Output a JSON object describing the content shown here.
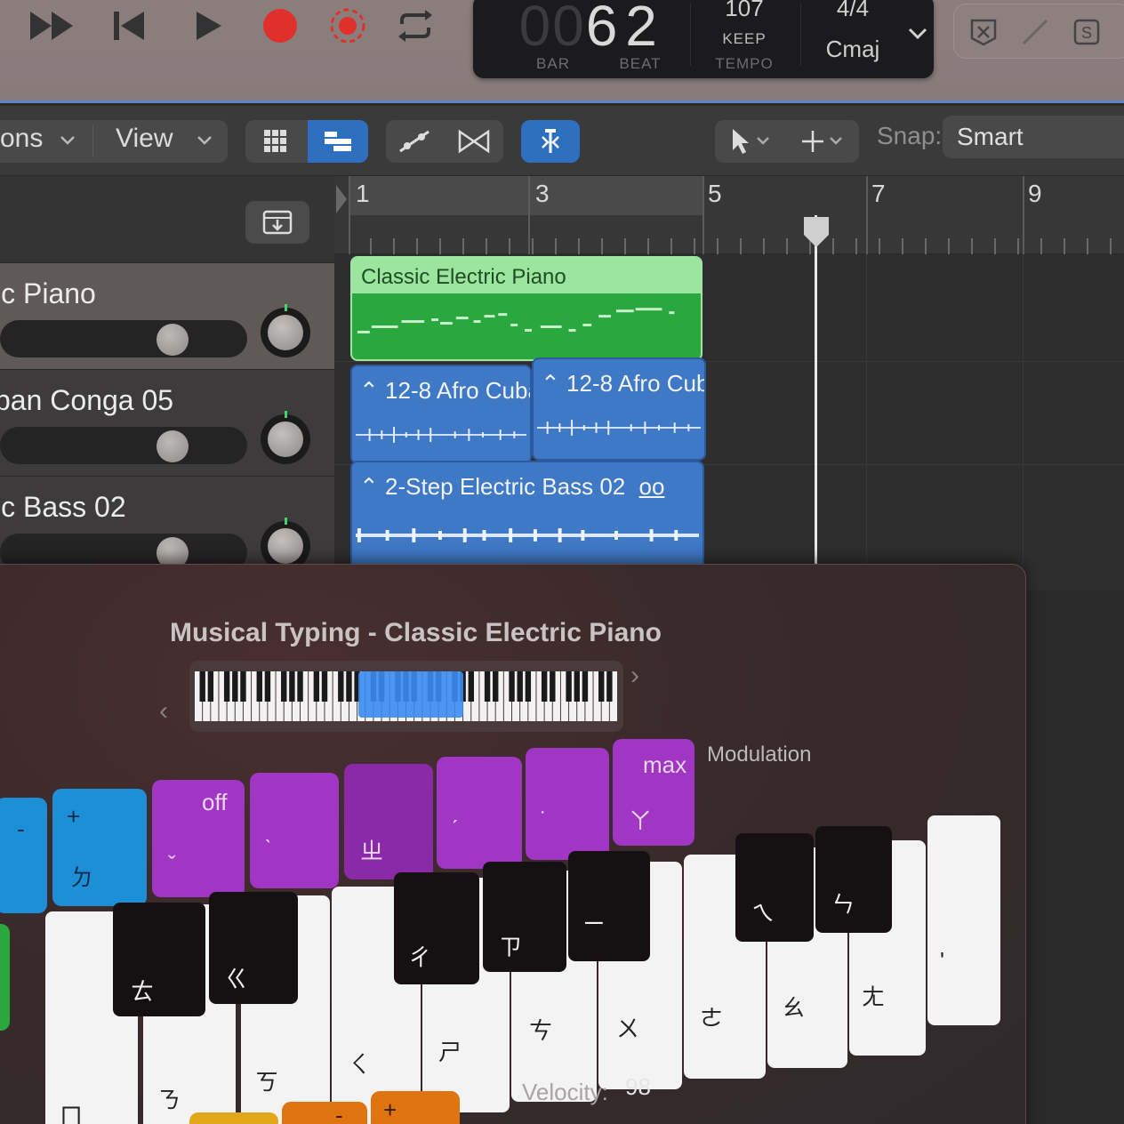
{
  "transport": {
    "lcd": {
      "bar_dim": "00",
      "bar": "6",
      "beat": "2",
      "bar_label": "BAR",
      "beat_label": "BEAT",
      "tempo": "107",
      "tempo_mode": "KEEP",
      "tempo_label": "TEMPO",
      "time_sig": "4/4",
      "key": "Cmaj"
    },
    "record_color": "#e0302b"
  },
  "toolbar": {
    "menu1": "ons",
    "menu2": "View",
    "snap_label": "Snap:",
    "snap_value": "Smart"
  },
  "tracks": [
    {
      "name": "ic Piano"
    },
    {
      "name": "ban Conga 05"
    },
    {
      "name": "ic Bass 02"
    }
  ],
  "ruler": {
    "bars": [
      "1",
      "3",
      "5",
      "7",
      "9"
    ]
  },
  "regions": {
    "piano": "Classic Electric Piano",
    "conga_a": "12-8 Afro Cuba",
    "conga_b": "12-8 Afro Cuba",
    "bass": "2-Step Electric Bass 02",
    "loop_glyph": "oo"
  },
  "musical_typing": {
    "title": "Musical Typing - Classic Electric Piano",
    "modulation_label": "Modulation",
    "velocity_label": "Velocity:",
    "velocity_value": "98",
    "octave_keys": {
      "minus": "-",
      "plus": "+",
      "plus_zhuyin": "ㄉ"
    },
    "mod_keys": {
      "off": "off",
      "off_zhuyin": "ˇ",
      "k2": "ˋ",
      "k3": "ㄓ",
      "k4": "ˊ",
      "k5": "˙",
      "max": "max",
      "max_zhuyin": "ㄚ"
    },
    "black_keys": [
      "ㄊ",
      "ㄍ",
      "ㄔ",
      "ㄗ",
      "ㄧ",
      "ㄟ",
      "ㄣ"
    ],
    "white_keys": [
      "ㄇ",
      "ㄋ",
      "ㄎ",
      "ㄑ",
      "ㄕ",
      "ㄘ",
      "ㄨ",
      "ㄜ",
      "ㄠ",
      "ㄤ",
      "'"
    ],
    "bottom_keys": [
      "-",
      "+"
    ]
  }
}
